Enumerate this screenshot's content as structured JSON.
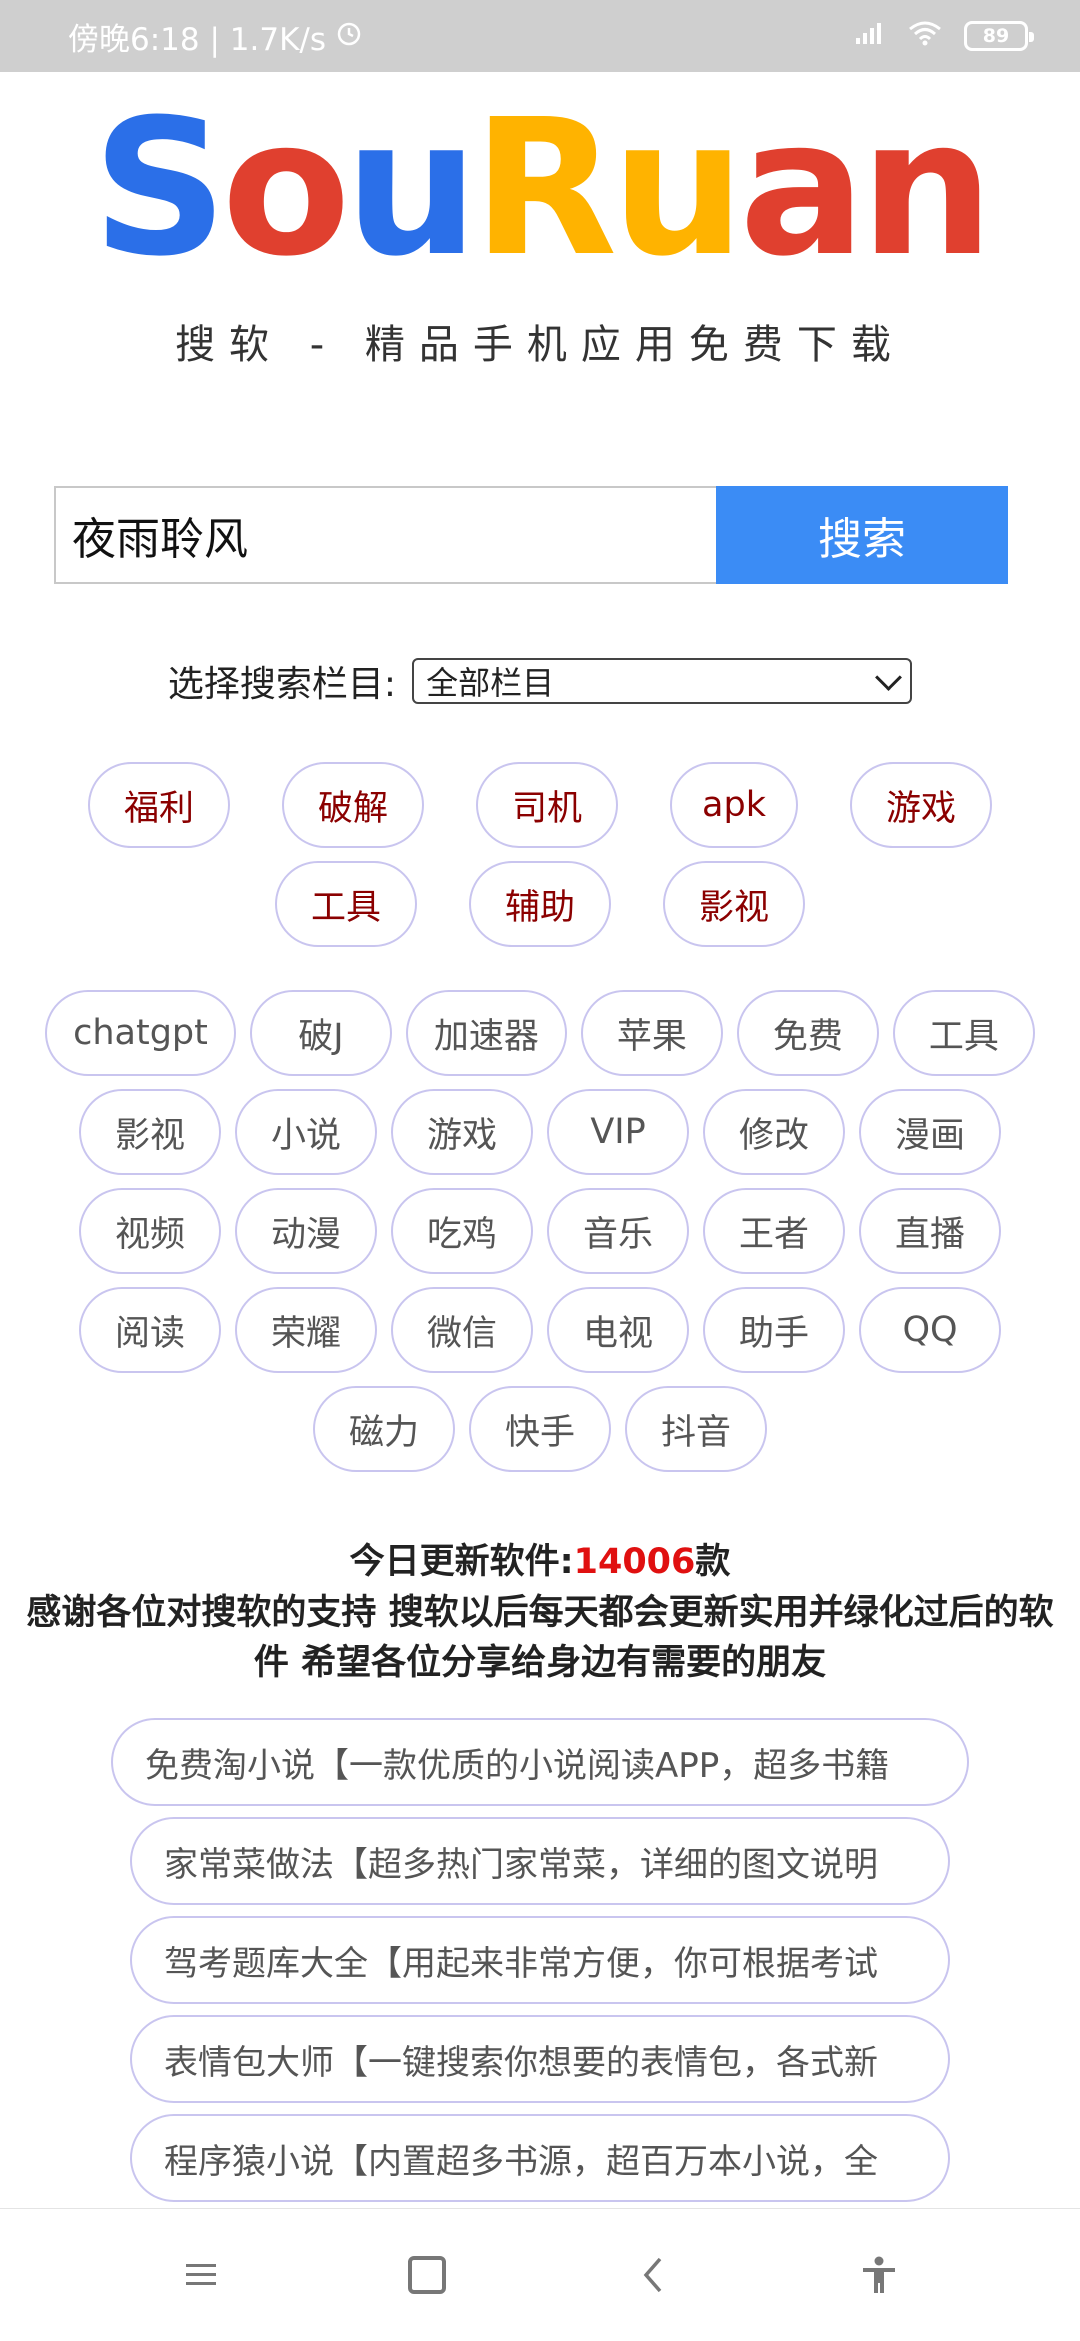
{
  "status_bar": {
    "time_speed": "傍晚6:18 | 1.7K/s",
    "battery": "89"
  },
  "logo": {
    "letters": [
      {
        "char": "S",
        "color": "#2b6fe8"
      },
      {
        "char": "o",
        "color": "#e0402f"
      },
      {
        "char": "u",
        "color": "#2b6fe8"
      },
      {
        "char": "R",
        "color": "#ffb300"
      },
      {
        "char": "u",
        "color": "#ffb300"
      },
      {
        "char": "a",
        "color": "#e0402f"
      },
      {
        "char": "n",
        "color": "#e0402f"
      }
    ],
    "tagline": "搜软 - 精品手机应用免费下载"
  },
  "search": {
    "value": "夜雨聆风",
    "button_label": "搜索",
    "button_color": "#3b8cf5"
  },
  "category": {
    "label": "选择搜索栏目:",
    "selected": "全部栏目"
  },
  "hot_tags": [
    "福利",
    "破解",
    "司机",
    "apk",
    "游戏",
    "工具",
    "辅助",
    "影视"
  ],
  "tags": [
    "chatgpt",
    "破J",
    "加速器",
    "苹果",
    "免费",
    "工具",
    "影视",
    "小说",
    "游戏",
    "VIP",
    "修改",
    "漫画",
    "视频",
    "动漫",
    "吃鸡",
    "音乐",
    "王者",
    "直播",
    "阅读",
    "荣耀",
    "微信",
    "电视",
    "助手",
    "QQ",
    "磁力",
    "快手",
    "抖音"
  ],
  "update": {
    "prefix": "今日更新软件:",
    "count": "14006",
    "suffix": "款",
    "notice": "感谢各位对搜软的支持 搜软以后每天都会更新实用并绿化过后的软件 希望各位分享给身边有需要的朋友"
  },
  "apps": [
    "免费淘小说【一款优质的小说阅读APP，超多书籍",
    "家常菜做法【超多热门家常菜，详细的图文说明",
    "驾考题库大全【用起来非常方便，你可根据考试",
    "表情包大师【一键搜索你想要的表情包，各式新",
    "程序猿小说【内置超多书源，超百万本小说，全"
  ],
  "nav": {
    "menu_icon": "menu-icon",
    "home_icon": "home-icon",
    "back_icon": "back-icon",
    "accessibility_icon": "accessibility-icon"
  }
}
